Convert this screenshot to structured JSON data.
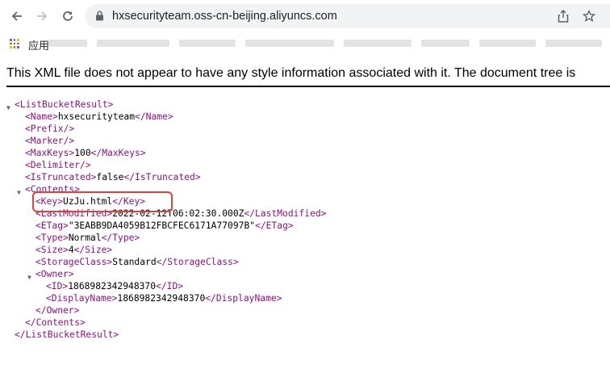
{
  "browser": {
    "url": "hxsecurityteam.oss-cn-beijing.aliyuncs.com",
    "bookmarks_apps_label": "应用"
  },
  "notice": "This XML file does not appear to have any style information associated with it. The document tree is",
  "xml": {
    "root_open": "<ListBucketResult>",
    "name": [
      "<Name>",
      "hxsecurityteam",
      "</Name>"
    ],
    "prefix": "<Prefix/>",
    "marker": "<Marker/>",
    "maxkeys": [
      "<MaxKeys>",
      "100",
      "</MaxKeys>"
    ],
    "delimiter": "<Delimiter/>",
    "istruncated": [
      "<IsTruncated>",
      "false",
      "</IsTruncated>"
    ],
    "contents_open": "<Contents>",
    "key": [
      "<Key>",
      "UzJu.html",
      "</Key>"
    ],
    "lastmodified": [
      "<LastModified>",
      "2022-02-12T06:02:30.000Z",
      "</LastModified>"
    ],
    "etag": [
      "<ETag>",
      "\"3EABB9DA4059B12FBCFEC6171A77097B\"",
      "</ETag>"
    ],
    "type": [
      "<Type>",
      "Normal",
      "</Type>"
    ],
    "size": [
      "<Size>",
      "4",
      "</Size>"
    ],
    "storageclass": [
      "<StorageClass>",
      "Standard",
      "</StorageClass>"
    ],
    "owner_open": "<Owner>",
    "id": [
      "<ID>",
      "1868982342948370",
      "</ID>"
    ],
    "displayname": [
      "<DisplayName>",
      "1868982342948370",
      "</DisplayName>"
    ],
    "owner_close": "</Owner>",
    "contents_close": "</Contents>",
    "root_close": "</ListBucketResult>"
  },
  "colors": {
    "tag": "#881280",
    "highlight": "#e0403a"
  }
}
